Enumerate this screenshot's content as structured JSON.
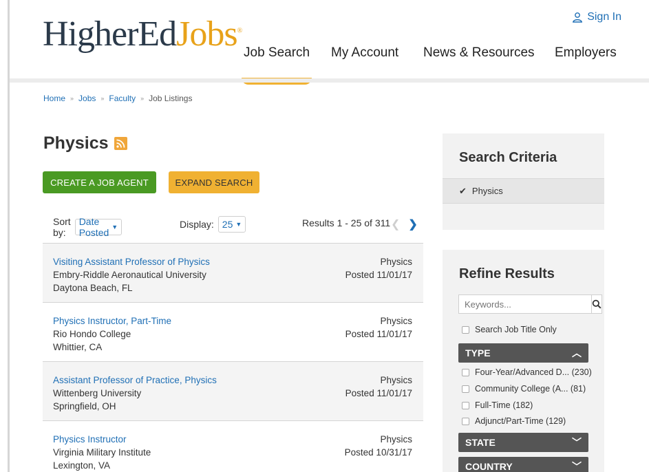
{
  "header": {
    "logo_part1": "HigherEd",
    "logo_part2": "Jobs",
    "logo_mark": "®",
    "signin_label": "Sign In",
    "nav": [
      {
        "label": "Job Search",
        "active": true
      },
      {
        "label": "My Account"
      },
      {
        "label": "News & Resources"
      },
      {
        "label": "Employers"
      }
    ]
  },
  "breadcrumb": [
    "Home",
    "Jobs",
    "Faculty",
    "Job Listings"
  ],
  "page": {
    "title": "Physics",
    "create_agent_label": "CREATE A JOB AGENT",
    "expand_search_label": "EXPAND SEARCH",
    "sort_label": "Sort by:",
    "sort_value": "Date Posted",
    "display_label": "Display:",
    "display_value": "25",
    "results_text": "Results 1 - 25 of 311"
  },
  "jobs": [
    {
      "title": "Visiting Assistant Professor of Physics",
      "institution": "Embry-Riddle Aeronautical University",
      "location": "Daytona Beach, FL",
      "category": "Physics",
      "posted": "Posted 11/01/17"
    },
    {
      "title": "Physics Instructor, Part-Time",
      "institution": "Rio Hondo College",
      "location": "Whittier, CA",
      "category": "Physics",
      "posted": "Posted 11/01/17"
    },
    {
      "title": "Assistant Professor of Practice, Physics",
      "institution": "Wittenberg University",
      "location": "Springfield, OH",
      "category": "Physics",
      "posted": "Posted 11/01/17"
    },
    {
      "title": "Physics Instructor",
      "institution": "Virginia Military Institute",
      "location": "Lexington, VA",
      "category": "Physics",
      "posted": "Posted 10/31/17"
    }
  ],
  "sidebar": {
    "criteria_title": "Search Criteria",
    "criteria_item": "Physics",
    "refine_title": "Refine Results",
    "keywords_placeholder": "Keywords...",
    "title_only_label": "Search Job Title Only",
    "type_label": "TYPE",
    "type_options": [
      "Four-Year/Advanced D... (230)",
      "Community College (A... (81)",
      "Full-Time (182)",
      "Adjunct/Part-Time (129)"
    ],
    "state_label": "STATE",
    "country_label": "COUNTRY"
  },
  "colors": {
    "link": "#1f6fb5",
    "accent": "#f0b132",
    "green": "#4a9a23",
    "facet_bg": "#555555"
  }
}
